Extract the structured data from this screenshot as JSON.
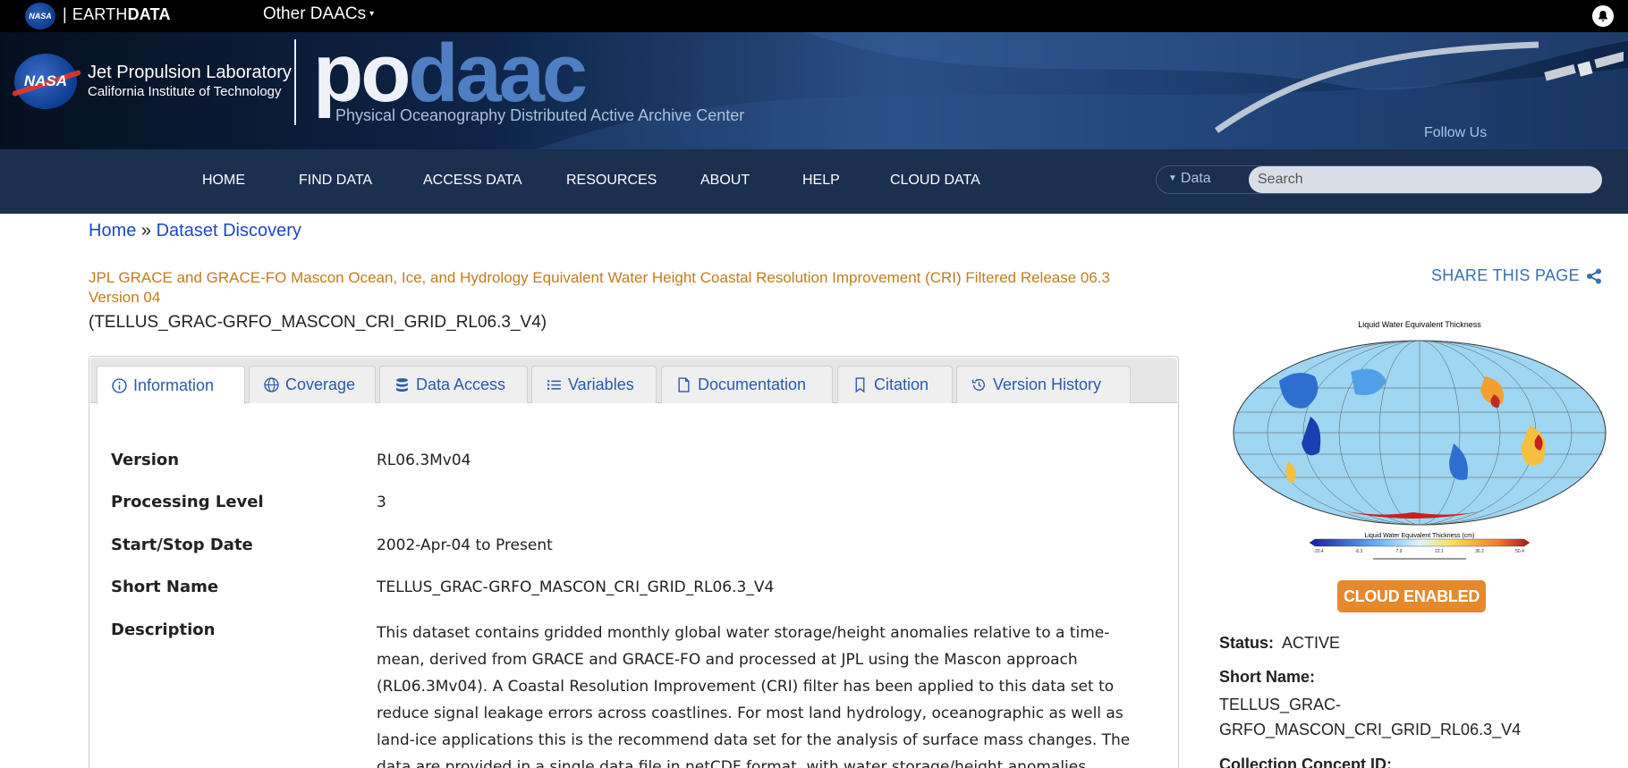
{
  "topbar": {
    "brand_prefix": "EARTH",
    "brand_suffix": "DATA",
    "separator": "|",
    "other_daacs": "Other DAACs"
  },
  "banner": {
    "jpl_title": "Jet Propulsion Laboratory",
    "jpl_subtitle": "California Institute of Technology",
    "wordmark_a": "po",
    "wordmark_b": "daac",
    "tagline": "Physical Oceanography Distributed Active Archive Center",
    "follow_us": "Follow Us"
  },
  "nav": {
    "items": [
      "HOME",
      "FIND DATA",
      "ACCESS DATA",
      "RESOURCES",
      "ABOUT",
      "HELP",
      "CLOUD DATA"
    ],
    "data_dropdown": "Data",
    "search_placeholder": "Search"
  },
  "breadcrumb": {
    "home": "Home",
    "sep": "»",
    "current": "Dataset Discovery"
  },
  "dataset": {
    "title": "JPL GRACE and GRACE-FO Mascon Ocean, Ice, and Hydrology Equivalent Water Height Coastal Resolution Improvement (CRI) Filtered Release 06.3 Version 04",
    "short_name_paren": "(TELLUS_GRAC-GRFO_MASCON_CRI_GRID_RL06.3_V4)"
  },
  "share": {
    "label": "SHARE THIS PAGE"
  },
  "tabs": [
    "Information",
    "Coverage",
    "Data Access",
    "Variables",
    "Documentation",
    "Citation",
    "Version History"
  ],
  "info": {
    "rows": [
      {
        "label": "Version",
        "value": "RL06.3Mv04"
      },
      {
        "label": "Processing Level",
        "value": "3"
      },
      {
        "label": "Start/Stop Date",
        "value": "2002-Apr-04 to Present"
      },
      {
        "label": "Short Name",
        "value": "TELLUS_GRAC-GRFO_MASCON_CRI_GRID_RL06.3_V4"
      },
      {
        "label": "Description",
        "value": ""
      }
    ],
    "description": "This dataset contains gridded monthly global water storage/height anomalies relative to a time-mean, derived from GRACE and GRACE-FO and processed at JPL using the Mascon approach (RL06.3Mv04). A Coastal Resolution Improvement (CRI) filter has been applied to this data set to reduce signal leakage errors across coastlines. For most land hydrology, oceanographic as well as land-ice applications this is the recommend data set for the analysis of surface mass changes. The data are provided in a single data file in netCDF format, with water storage/height anomalies"
  },
  "map": {
    "title": "Liquid Water Equivalent Thickness",
    "colorbar_label": "Liquid Water Equivalent Thickness (cm)",
    "ticks": [
      "-20.4",
      "-6.3",
      "7.9",
      "22.1",
      "36.2",
      "50.4"
    ]
  },
  "sidebar": {
    "badge": "CLOUD ENABLED",
    "status_label": "Status:",
    "status_value": "ACTIVE",
    "short_name_label": "Short Name:",
    "short_name_line1": "TELLUS_GRAC-",
    "short_name_line2": "GRFO_MASCON_CRI_GRID_RL06.3_V4",
    "concept_label": "Collection Concept ID:"
  },
  "colors": {
    "nav_bg": "#1b2f4e",
    "link": "#1d46c8",
    "title_orange": "#c27c1e",
    "badge_orange": "#e6892c",
    "tab_text": "#2b5aa6"
  }
}
